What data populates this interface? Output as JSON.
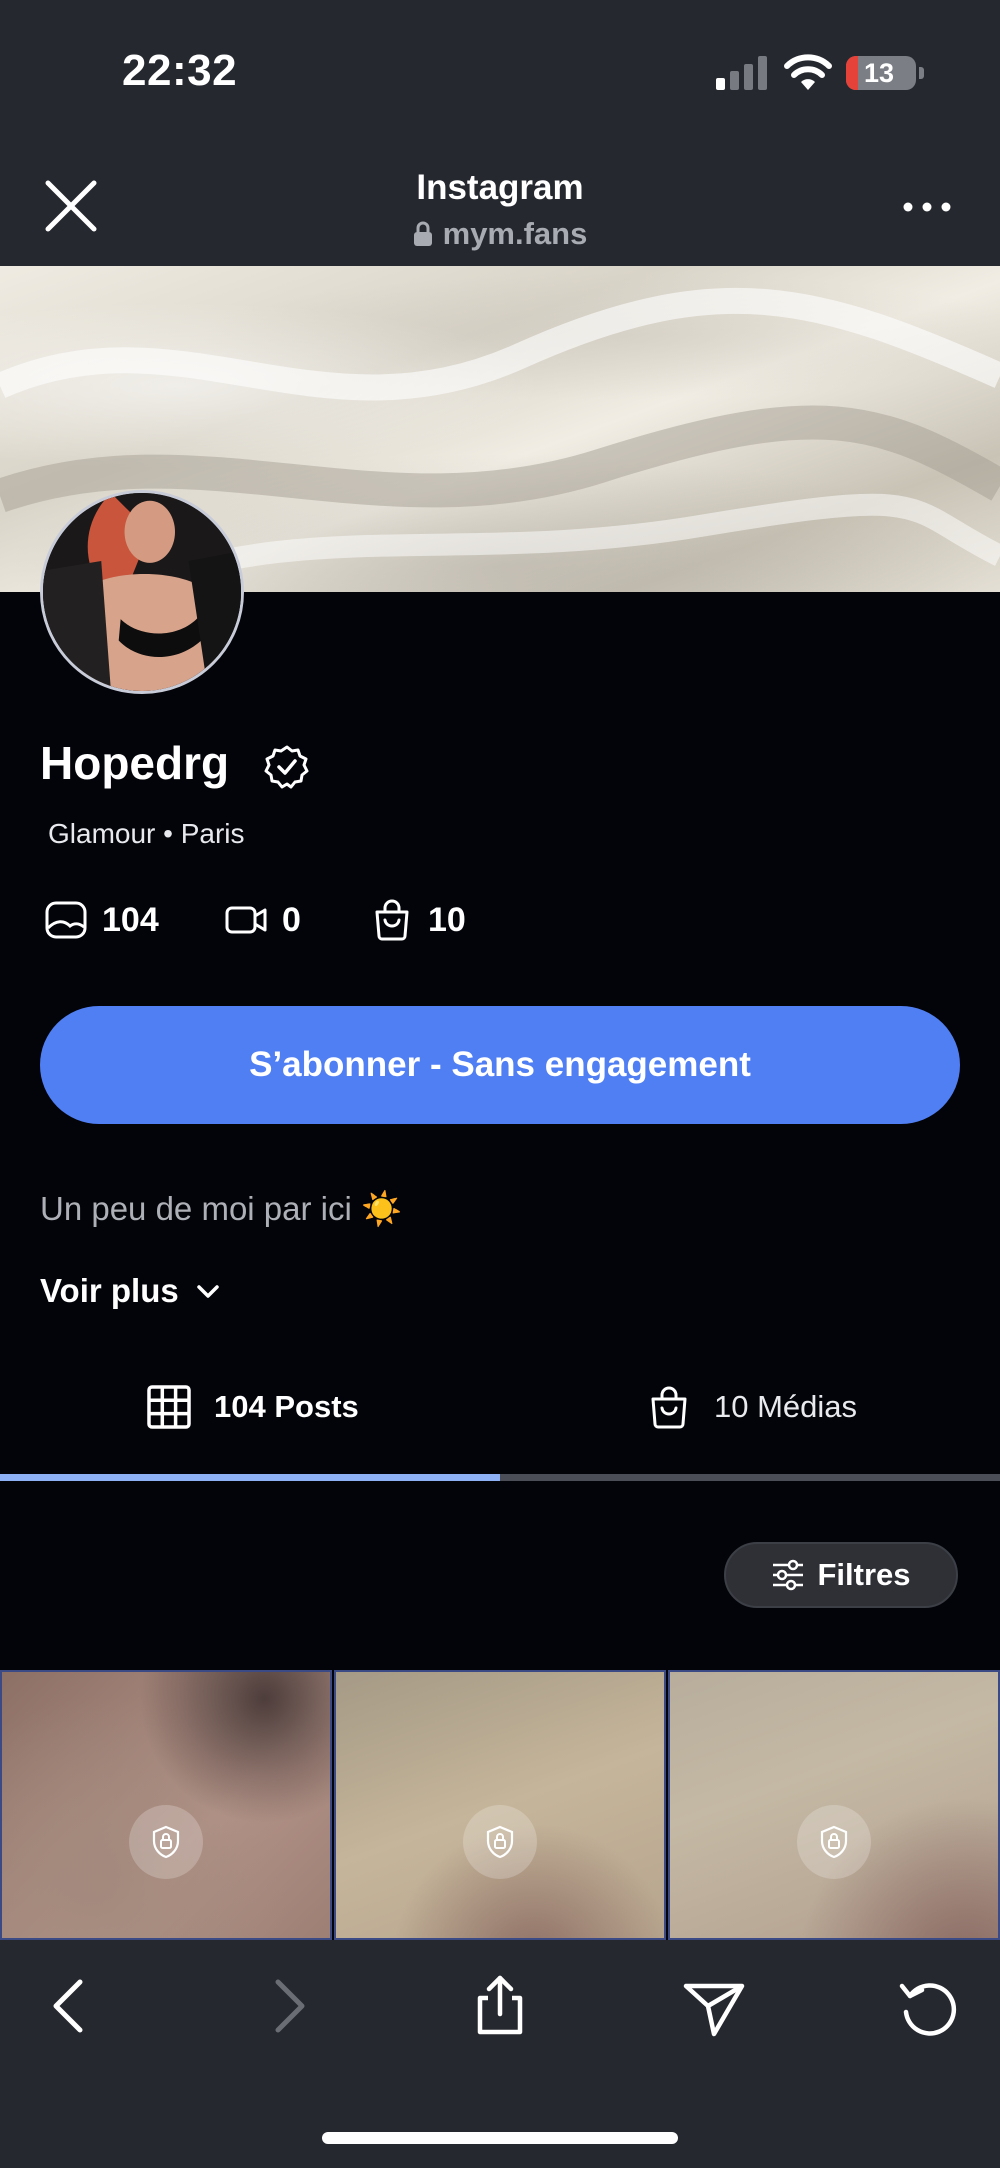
{
  "status_bar": {
    "time": "22:32",
    "battery_level": "13",
    "battery_color": "#e5423a"
  },
  "browser": {
    "title": "Instagram",
    "url": "mym.fans",
    "close_icon": "close-icon",
    "more_icon": "more-icon"
  },
  "profile": {
    "name": "Hopedrg",
    "tagline": "Glamour • Paris",
    "stats": {
      "posts": "104",
      "videos": "0",
      "medias": "10"
    },
    "subscribe_label": "S’abonner - Sans engagement",
    "bio": "Un peu de moi par ici",
    "bio_emoji": "☀️",
    "see_more_label": "Voir plus"
  },
  "tabs": [
    {
      "label": "104 Posts",
      "active": true
    },
    {
      "label": "10 Médias",
      "active": false
    }
  ],
  "filters_label": "Filtres",
  "colors": {
    "accent": "#507ff4",
    "tab_active": "#8eb1f6",
    "background": "#030409",
    "chrome": "#25282f"
  }
}
